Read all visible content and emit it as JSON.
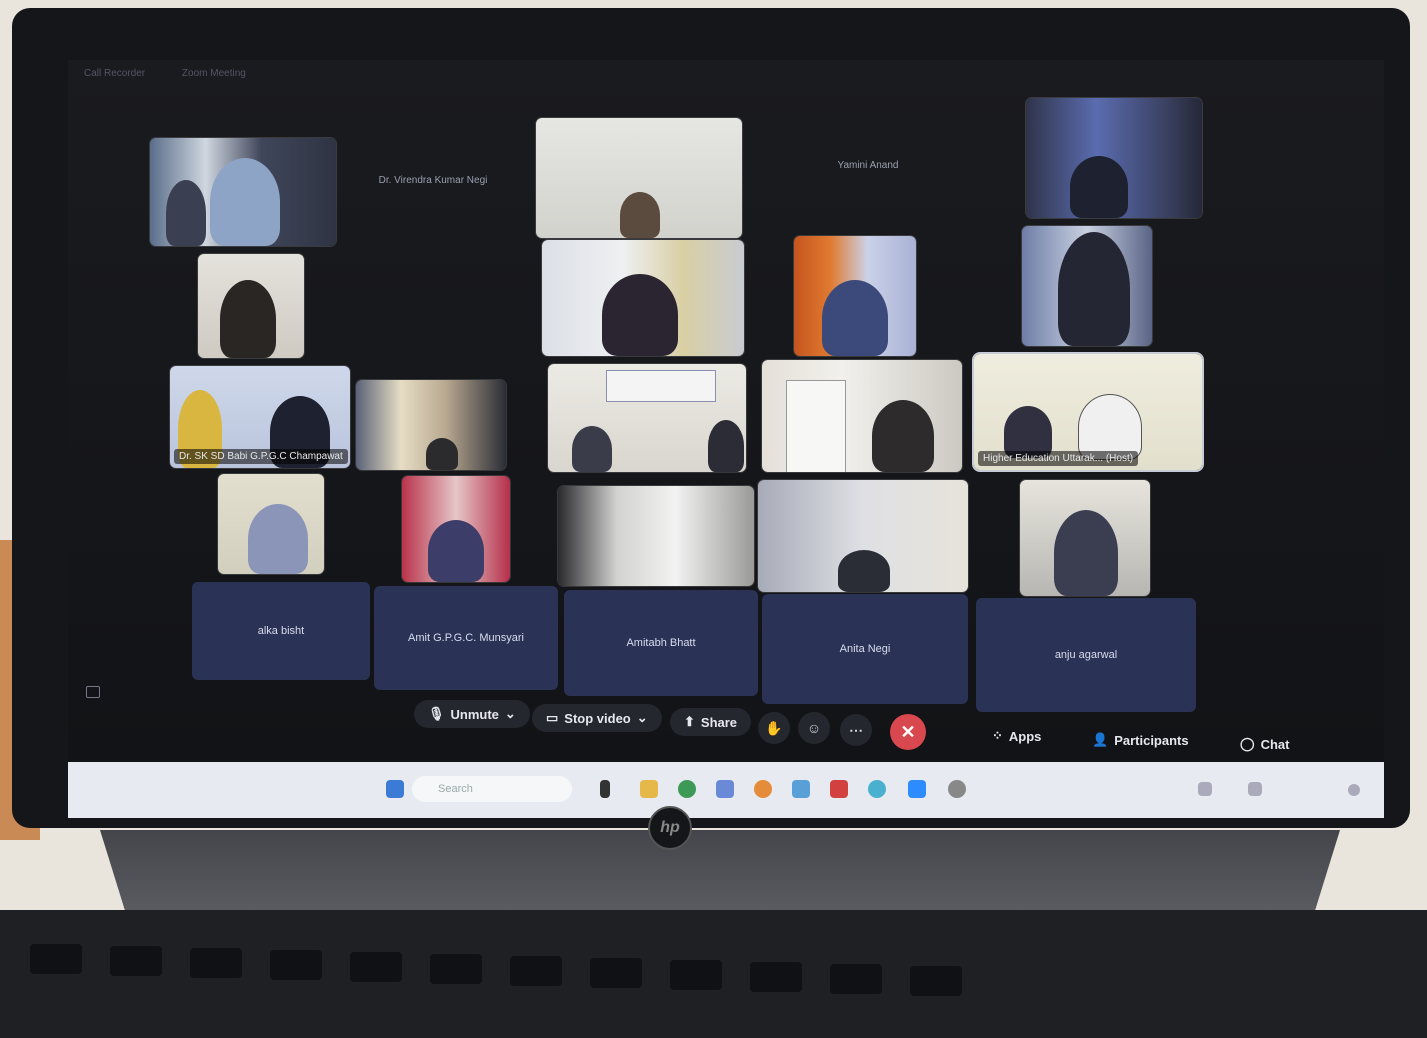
{
  "meeting": {
    "topbar": [
      "Call Recorder",
      "Zoom Meeting"
    ]
  },
  "tiles": {
    "row1": {
      "name_a": "Dr. Virendra Kumar Negi",
      "name_b": "Yamini Anand"
    },
    "row3": {
      "label_a": "Dr. SK SD Babi G.P.G.C Champawat",
      "label_host": "Higher Education Uttarak... (Host)"
    },
    "name_row": [
      "alka bisht",
      "Amit G.P.G.C. Munsyari",
      "Amitabh Bhatt",
      "Anita Negi",
      "anju agarwal"
    ]
  },
  "controls": {
    "unmute": "Unmute",
    "stop_video": "Stop video",
    "share": "Share",
    "apps": "Apps",
    "participants": "Participants",
    "chat": "Chat"
  },
  "taskbar": {
    "search_placeholder": "Search"
  },
  "brand": "hp",
  "colors": {
    "name_tile": "#2a3355",
    "end_call": "#d8484e",
    "taskbar": "#e7ebf1"
  }
}
